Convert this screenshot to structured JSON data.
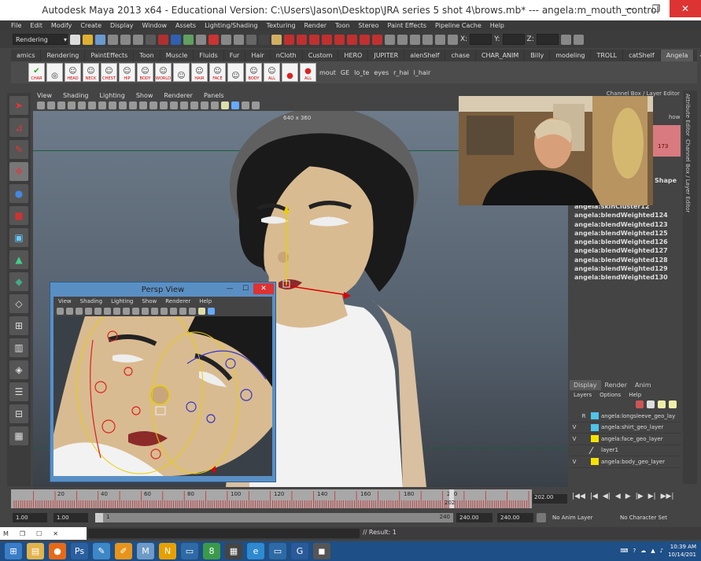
{
  "window": {
    "title": "Autodesk Maya 2013 x64 - Educational Version: C:\\Users\\Jason\\Desktop\\JRA series 5 shot 4\\brows.mb*   ---   angela:m_mouth_control",
    "minimize": "—",
    "restore": "❐",
    "close": "✕"
  },
  "menu": [
    "File",
    "Edit",
    "Modify",
    "Create",
    "Display",
    "Window",
    "Assets",
    "Lighting/Shading",
    "Texturing",
    "Render",
    "Toon",
    "Stereo",
    "Paint Effects",
    "Pipeline Cache",
    "Help"
  ],
  "statusline": {
    "menuset": "Rendering",
    "x_label": "X:",
    "y_label": "Y:",
    "z_label": "Z:"
  },
  "shelf_tabs": [
    "amics",
    "Rendering",
    "PaintEffects",
    "Toon",
    "Muscle",
    "Fluids",
    "Fur",
    "Hair",
    "nCloth",
    "Custom",
    "HERO",
    "JUPITER",
    "alenShelf",
    "chase",
    "CHAR_ANIM",
    "Billy",
    "modeling",
    "TROLL",
    "catShelf",
    "Angela"
  ],
  "shelf_active": "Angela",
  "shelf_buttons": [
    "CHAR",
    "",
    "HEAD",
    "NECK",
    "CHEST",
    "HIP",
    "BODY",
    "WORLD",
    "",
    "HAIR",
    "FACE",
    "",
    "BODY",
    "ALL",
    "",
    "ALL"
  ],
  "shelf_text_buttons": [
    "mout",
    "GE",
    "lo_te",
    "eyes",
    "r_hai",
    "l_hair"
  ],
  "viewport": {
    "menu": [
      "View",
      "Shading",
      "Lighting",
      "Show",
      "Renderer",
      "Panels"
    ],
    "resolution_gate": "640 x 360"
  },
  "channel_box": {
    "partial_label": "Channel Box / Layer Editor",
    "shape_label": "Shape",
    "value_partial": "173",
    "show_label": "how",
    "items": [
      "angela:skinCluster12",
      "angela:blendWeighted124",
      "angela:blendWeighted123",
      "angela:blendWeighted125",
      "angela:blendWeighted126",
      "angela:blendWeighted127",
      "angela:blendWeighted128",
      "angela:blendWeighted129",
      "angela:blendWeighted130"
    ]
  },
  "side_tabs": [
    "Attribute Editor",
    "Channel Box / Layer Editor"
  ],
  "layer_editor": {
    "tabs": [
      "Display",
      "Render",
      "Anim"
    ],
    "active_tab": "Display",
    "menu": [
      "Layers",
      "Options",
      "Help"
    ],
    "layers": [
      {
        "v": "",
        "r": "R",
        "color": "#4fc3e8",
        "name": "angela:longsleeve_geo_lay"
      },
      {
        "v": "V",
        "r": "",
        "color": "#4fc3e8",
        "name": "angela:shirt_geo_layer"
      },
      {
        "v": "V",
        "r": "",
        "color": "#f5e200",
        "name": "angela:face_geo_layer"
      },
      {
        "v": "",
        "r": "",
        "color": "none",
        "name": "layer1"
      },
      {
        "v": "V",
        "r": "",
        "color": "#f5e200",
        "name": "angela:body_geo_layer"
      }
    ]
  },
  "persp_window": {
    "title": "Persp View",
    "menu": [
      "View",
      "Shading",
      "Lighting",
      "Show",
      "Renderer",
      "Help"
    ],
    "minimize": "—",
    "maximize": "☐",
    "close": "✕"
  },
  "timeline": {
    "labels": [
      "20",
      "40",
      "60",
      "80",
      "100",
      "120",
      "140",
      "160",
      "180",
      "200"
    ],
    "current_frame": "202",
    "current_field": "202.00",
    "total": 240
  },
  "range": {
    "start_field": "1.00",
    "start2_field": "1.00",
    "slider_start": "1",
    "slider_end": "240",
    "end_field": "240.00",
    "end2_field": "240.00",
    "anim_layer": "No Anim Layer",
    "character_set": "No Character Set"
  },
  "mel": {
    "label": "M",
    "result": "// Result: 1"
  },
  "taskbar": {
    "time": "10:39 AM",
    "date": "10/14/201"
  },
  "colors": {
    "maya_bg": "#444444",
    "taskbar": "#1e4f86",
    "persp_frame": "#5a8fc4",
    "close_red": "#d33333",
    "timeline": "#a8a8a8"
  }
}
